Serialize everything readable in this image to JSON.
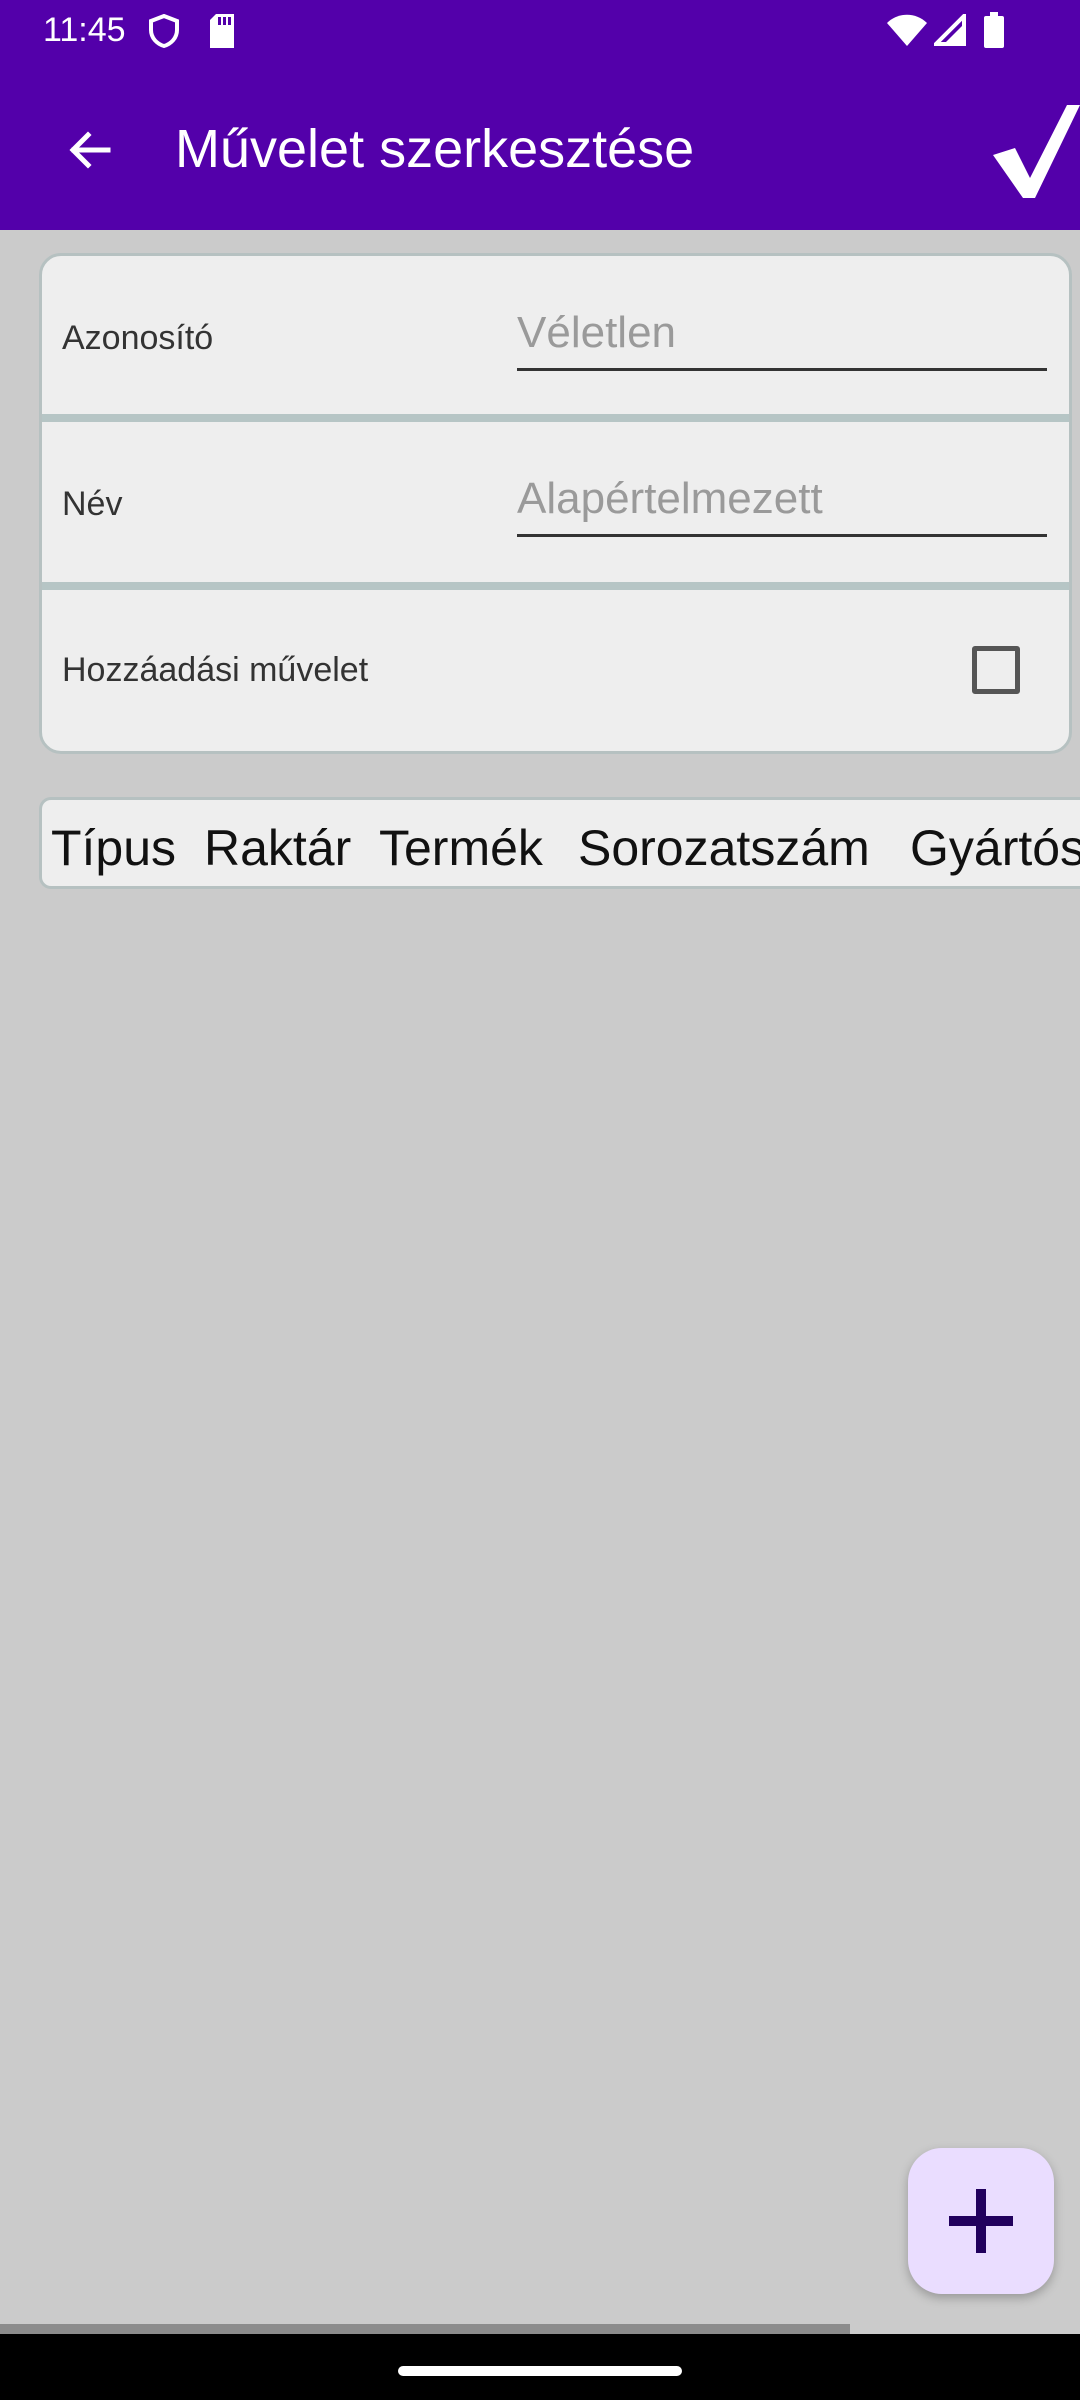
{
  "status_bar": {
    "time": "11:45",
    "icons": [
      "shield-icon",
      "sd-card-icon",
      "wifi-icon",
      "signal-icon",
      "battery-icon"
    ]
  },
  "app_bar": {
    "title": "Művelet szerkesztése",
    "back_icon": "arrow-back-icon",
    "save_icon": "checkmark-icon",
    "background_color": "#5300aa"
  },
  "form": {
    "id_label": "Azonosító",
    "id_placeholder": "Véletlen",
    "name_label": "Név",
    "name_placeholder": "Alapértelmezett",
    "add_label": "Hozzáadási művelet",
    "add_checked": false
  },
  "table": {
    "columns": [
      "Típus",
      "Raktár",
      "Termék",
      "Sorozatszám",
      "Gyártós"
    ]
  },
  "fab": {
    "icon": "plus-icon",
    "color": "#eaddff"
  }
}
